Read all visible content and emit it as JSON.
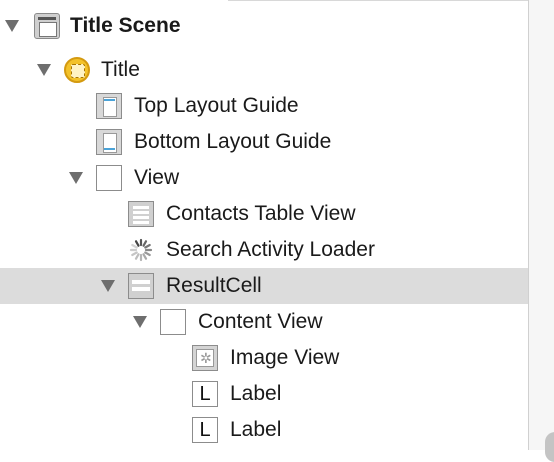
{
  "outline": {
    "items": [
      {
        "label": "Title Scene",
        "icon": "scene-icon"
      },
      {
        "label": "Title",
        "icon": "view-controller-icon"
      },
      {
        "label": "Top Layout Guide",
        "icon": "top-layout-guide-icon"
      },
      {
        "label": "Bottom Layout Guide",
        "icon": "bottom-layout-guide-icon"
      },
      {
        "label": "View",
        "icon": "view-icon"
      },
      {
        "label": "Contacts Table View",
        "icon": "table-view-icon"
      },
      {
        "label": "Search Activity Loader",
        "icon": "activity-indicator-icon"
      },
      {
        "label": "ResultCell",
        "icon": "table-cell-icon",
        "selected": true
      },
      {
        "label": "Content View",
        "icon": "view-icon"
      },
      {
        "label": "Image View",
        "icon": "image-view-icon"
      },
      {
        "label": "Label",
        "icon": "label-icon",
        "glyph": "L"
      },
      {
        "label": "Label",
        "icon": "label-icon",
        "glyph": "L"
      }
    ]
  },
  "colors": {
    "selection": "#dcdcdc",
    "view_controller": "#f3c22a",
    "layout_guide_accent": "#4aa3d8"
  }
}
